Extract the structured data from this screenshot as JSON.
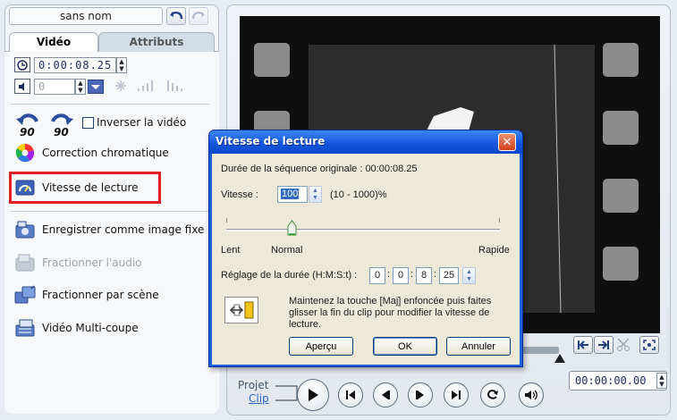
{
  "clip_panel": {
    "clip_name": "sans nom",
    "tabs": [
      "Vidéo",
      "Attributs"
    ],
    "duration": "0:00:08.25",
    "volume_value": "0",
    "options": {
      "reverse_video": "Inverser la vidéo",
      "color_correction": "Correction chromatique",
      "playback_speed": "Vitesse de lecture",
      "save_still": "Enregistrer comme image fixe",
      "split_audio": "Fractionner l'audio",
      "split_by_scene": "Fractionner par scène",
      "multi_trim": "Vidéo Multi-coupe"
    },
    "rotate_label": "90"
  },
  "preview": {
    "mode_project": "Projet",
    "mode_clip": "Clip",
    "timecode": "00:00:00.00"
  },
  "dialog": {
    "title": "Vitesse de lecture",
    "original_duration_label": "Durée de la séquence originale : 00:00:08.25",
    "speed_label": "Vitesse :",
    "speed_value": "100",
    "speed_range": "(10 - 1000)%",
    "slider_min_label": "Lent",
    "slider_mid_label": "Normal",
    "slider_max_label": "Rapide",
    "slider_level_fraction": 0.24,
    "duration_label": "Réglage de la durée (H:M:S:t) :",
    "duration_fields": [
      "0",
      "0",
      "8",
      "25"
    ],
    "hint": "Maintenez la touche [Maj] enfoncée puis faites glisser la fin du clip pour modifier la vitesse de lecture.",
    "buttons": {
      "preview": "Aperçu",
      "ok": "OK",
      "cancel": "Annuler"
    }
  },
  "colors": {
    "highlight": "#e31e24",
    "titlebar": "#1f5de0",
    "close": "#d0411c"
  }
}
